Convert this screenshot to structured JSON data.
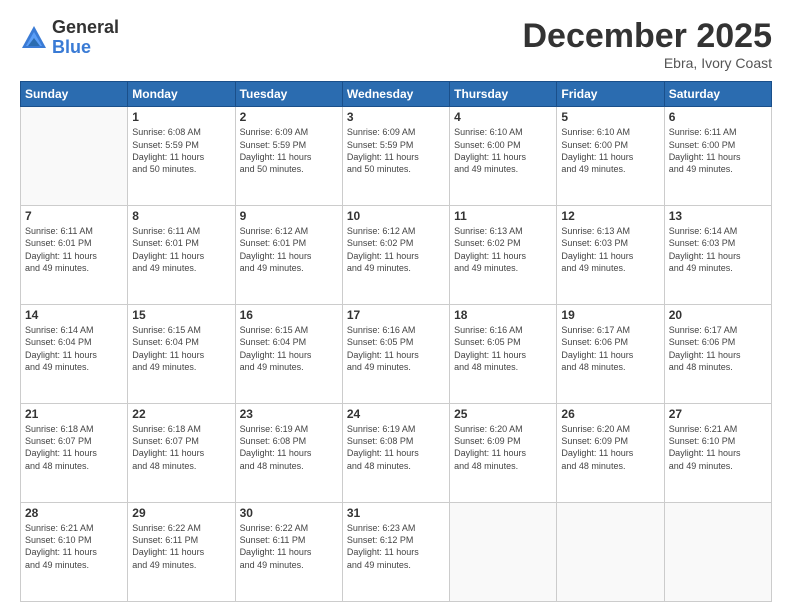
{
  "logo": {
    "general": "General",
    "blue": "Blue"
  },
  "header": {
    "month": "December 2025",
    "location": "Ebra, Ivory Coast"
  },
  "days": [
    "Sunday",
    "Monday",
    "Tuesday",
    "Wednesday",
    "Thursday",
    "Friday",
    "Saturday"
  ],
  "weeks": [
    [
      {
        "num": "",
        "info": ""
      },
      {
        "num": "1",
        "info": "Sunrise: 6:08 AM\nSunset: 5:59 PM\nDaylight: 11 hours\nand 50 minutes."
      },
      {
        "num": "2",
        "info": "Sunrise: 6:09 AM\nSunset: 5:59 PM\nDaylight: 11 hours\nand 50 minutes."
      },
      {
        "num": "3",
        "info": "Sunrise: 6:09 AM\nSunset: 5:59 PM\nDaylight: 11 hours\nand 50 minutes."
      },
      {
        "num": "4",
        "info": "Sunrise: 6:10 AM\nSunset: 6:00 PM\nDaylight: 11 hours\nand 49 minutes."
      },
      {
        "num": "5",
        "info": "Sunrise: 6:10 AM\nSunset: 6:00 PM\nDaylight: 11 hours\nand 49 minutes."
      },
      {
        "num": "6",
        "info": "Sunrise: 6:11 AM\nSunset: 6:00 PM\nDaylight: 11 hours\nand 49 minutes."
      }
    ],
    [
      {
        "num": "7",
        "info": "Sunrise: 6:11 AM\nSunset: 6:01 PM\nDaylight: 11 hours\nand 49 minutes."
      },
      {
        "num": "8",
        "info": "Sunrise: 6:11 AM\nSunset: 6:01 PM\nDaylight: 11 hours\nand 49 minutes."
      },
      {
        "num": "9",
        "info": "Sunrise: 6:12 AM\nSunset: 6:01 PM\nDaylight: 11 hours\nand 49 minutes."
      },
      {
        "num": "10",
        "info": "Sunrise: 6:12 AM\nSunset: 6:02 PM\nDaylight: 11 hours\nand 49 minutes."
      },
      {
        "num": "11",
        "info": "Sunrise: 6:13 AM\nSunset: 6:02 PM\nDaylight: 11 hours\nand 49 minutes."
      },
      {
        "num": "12",
        "info": "Sunrise: 6:13 AM\nSunset: 6:03 PM\nDaylight: 11 hours\nand 49 minutes."
      },
      {
        "num": "13",
        "info": "Sunrise: 6:14 AM\nSunset: 6:03 PM\nDaylight: 11 hours\nand 49 minutes."
      }
    ],
    [
      {
        "num": "14",
        "info": "Sunrise: 6:14 AM\nSunset: 6:04 PM\nDaylight: 11 hours\nand 49 minutes."
      },
      {
        "num": "15",
        "info": "Sunrise: 6:15 AM\nSunset: 6:04 PM\nDaylight: 11 hours\nand 49 minutes."
      },
      {
        "num": "16",
        "info": "Sunrise: 6:15 AM\nSunset: 6:04 PM\nDaylight: 11 hours\nand 49 minutes."
      },
      {
        "num": "17",
        "info": "Sunrise: 6:16 AM\nSunset: 6:05 PM\nDaylight: 11 hours\nand 49 minutes."
      },
      {
        "num": "18",
        "info": "Sunrise: 6:16 AM\nSunset: 6:05 PM\nDaylight: 11 hours\nand 48 minutes."
      },
      {
        "num": "19",
        "info": "Sunrise: 6:17 AM\nSunset: 6:06 PM\nDaylight: 11 hours\nand 48 minutes."
      },
      {
        "num": "20",
        "info": "Sunrise: 6:17 AM\nSunset: 6:06 PM\nDaylight: 11 hours\nand 48 minutes."
      }
    ],
    [
      {
        "num": "21",
        "info": "Sunrise: 6:18 AM\nSunset: 6:07 PM\nDaylight: 11 hours\nand 48 minutes."
      },
      {
        "num": "22",
        "info": "Sunrise: 6:18 AM\nSunset: 6:07 PM\nDaylight: 11 hours\nand 48 minutes."
      },
      {
        "num": "23",
        "info": "Sunrise: 6:19 AM\nSunset: 6:08 PM\nDaylight: 11 hours\nand 48 minutes."
      },
      {
        "num": "24",
        "info": "Sunrise: 6:19 AM\nSunset: 6:08 PM\nDaylight: 11 hours\nand 48 minutes."
      },
      {
        "num": "25",
        "info": "Sunrise: 6:20 AM\nSunset: 6:09 PM\nDaylight: 11 hours\nand 48 minutes."
      },
      {
        "num": "26",
        "info": "Sunrise: 6:20 AM\nSunset: 6:09 PM\nDaylight: 11 hours\nand 48 minutes."
      },
      {
        "num": "27",
        "info": "Sunrise: 6:21 AM\nSunset: 6:10 PM\nDaylight: 11 hours\nand 49 minutes."
      }
    ],
    [
      {
        "num": "28",
        "info": "Sunrise: 6:21 AM\nSunset: 6:10 PM\nDaylight: 11 hours\nand 49 minutes."
      },
      {
        "num": "29",
        "info": "Sunrise: 6:22 AM\nSunset: 6:11 PM\nDaylight: 11 hours\nand 49 minutes."
      },
      {
        "num": "30",
        "info": "Sunrise: 6:22 AM\nSunset: 6:11 PM\nDaylight: 11 hours\nand 49 minutes."
      },
      {
        "num": "31",
        "info": "Sunrise: 6:23 AM\nSunset: 6:12 PM\nDaylight: 11 hours\nand 49 minutes."
      },
      {
        "num": "",
        "info": ""
      },
      {
        "num": "",
        "info": ""
      },
      {
        "num": "",
        "info": ""
      }
    ]
  ]
}
